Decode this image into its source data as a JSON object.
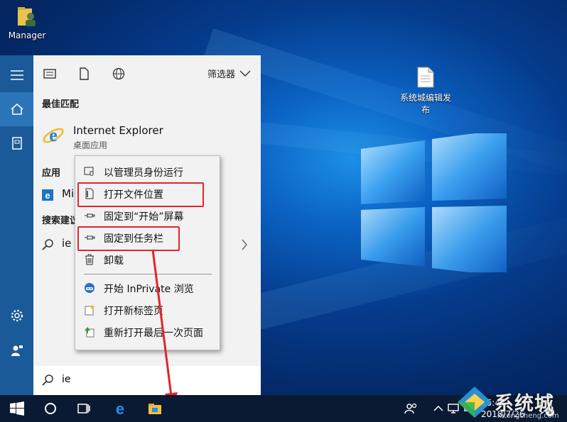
{
  "desktop": {
    "icons": [
      {
        "label": "Manager"
      },
      {
        "label": "系统城编辑发布"
      }
    ]
  },
  "start_menu": {
    "filter_label": "筛选器",
    "best_match_label": "最佳匹配",
    "best_match": {
      "title": "Internet Explorer",
      "subtitle": "桌面应用"
    },
    "apps_label": "应用",
    "app_item_partial": "Mi",
    "suggest_label": "搜索建议",
    "suggest_item_partial": "ie",
    "search_value": "ie"
  },
  "context_menu": {
    "items": [
      {
        "label": "以管理员身份运行",
        "icon": "shield-run-icon"
      },
      {
        "label": "打开文件位置",
        "icon": "file-location-icon"
      },
      {
        "label": "固定到“开始”屏幕",
        "icon": "pin-icon"
      },
      {
        "label": "固定到任务栏",
        "icon": "pin-icon"
      },
      {
        "label": "卸载",
        "icon": "trash-icon"
      },
      {
        "label": "开始 InPrivate 浏览",
        "icon": "inprivate-icon"
      },
      {
        "label": "打开新标签页",
        "icon": "new-tab-icon"
      },
      {
        "label": "重新打开最后一次页面",
        "icon": "reopen-icon"
      }
    ]
  },
  "taskbar": {
    "time": "15:41",
    "date": "2018/7/26",
    "notification_count": "1"
  },
  "watermark": {
    "text": "系统城",
    "sub": "xitongcheng.com"
  },
  "colors": {
    "accent": "#1a5a98",
    "highlight": "#e0262c",
    "taskbar": "#0b1a33"
  }
}
